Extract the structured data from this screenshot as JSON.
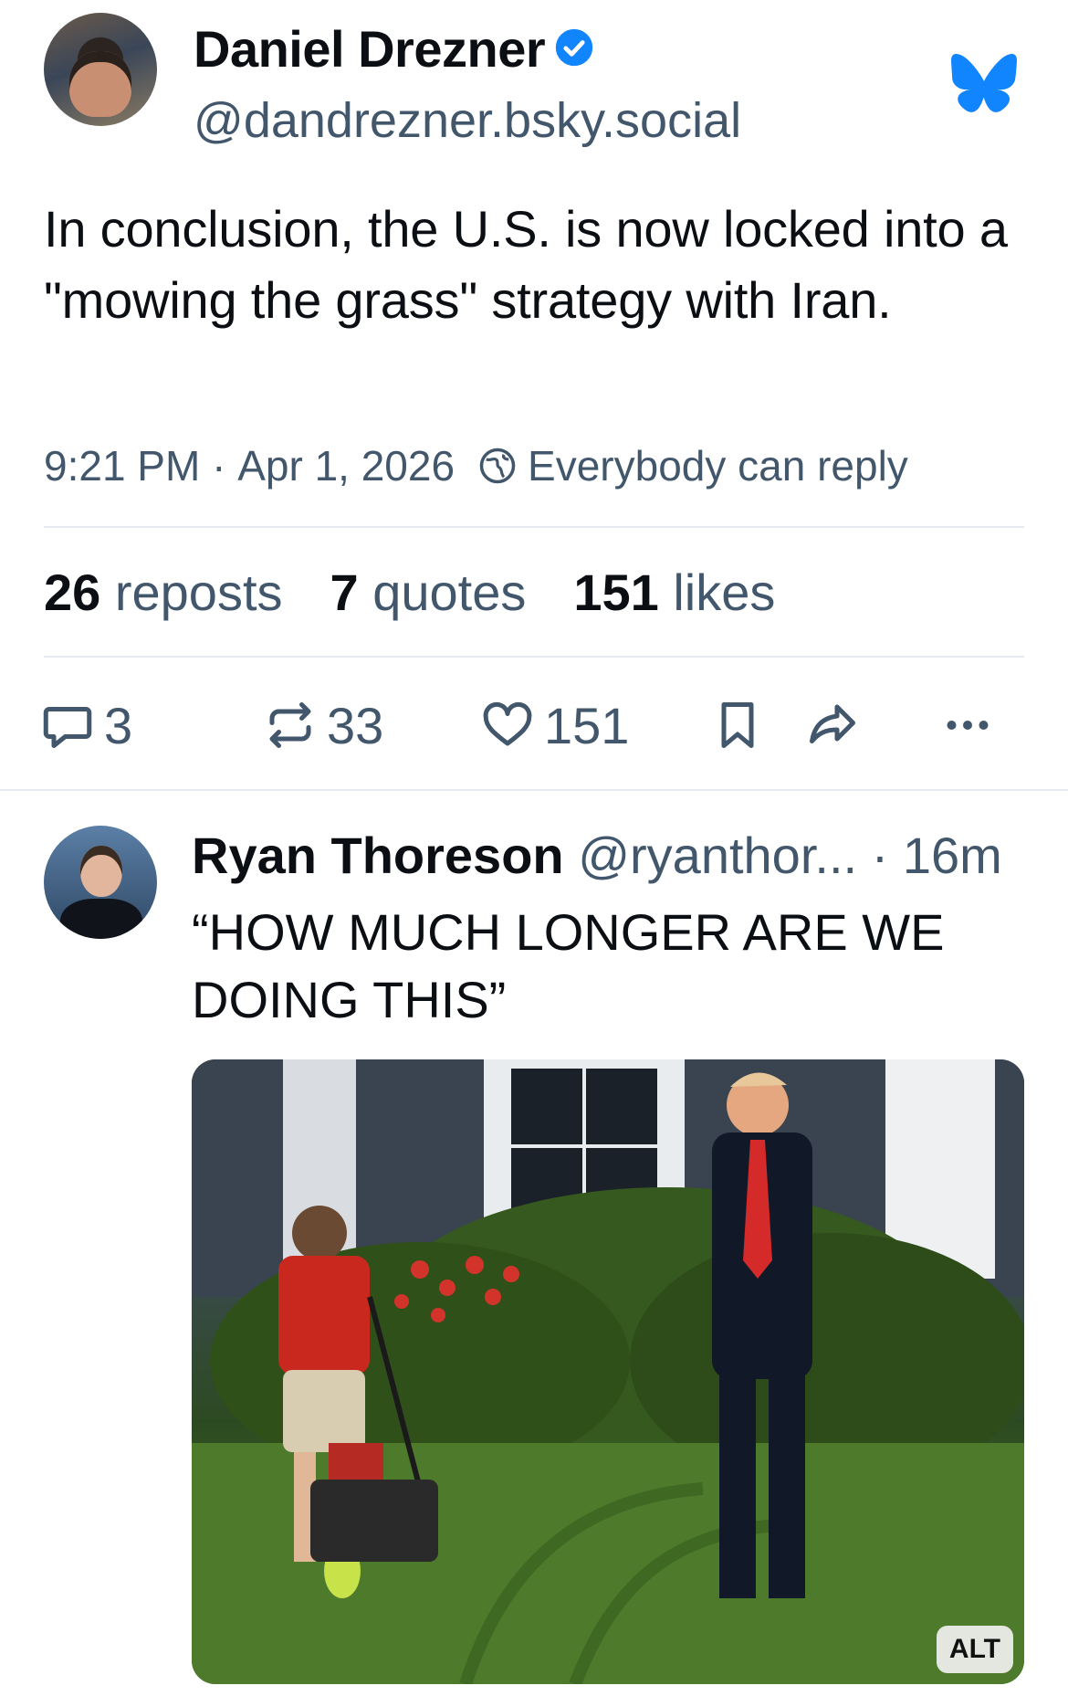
{
  "post": {
    "author_name": "Daniel Drezner",
    "author_handle": "@dandrezner.bsky.social",
    "text": "In conclusion, the U.S. is now locked into a \"mowing the grass\" strategy with Iran.",
    "time": "9:21 PM",
    "date": "Apr 1, 2026",
    "reply_setting": "Everybody can reply",
    "stats": {
      "reposts_count": "26",
      "reposts_label": "reposts",
      "quotes_count": "7",
      "quotes_label": "quotes",
      "likes_count": "151",
      "likes_label": "likes"
    },
    "actions": {
      "reply_count": "3",
      "repost_count": "33",
      "like_count": "151"
    }
  },
  "reply": {
    "author_name": "Ryan Thoreson",
    "author_handle": "@ryanthor...",
    "time": "· 16m",
    "text": "“HOW MUCH LONGER ARE WE DOING THIS”",
    "image_alt_badge": "ALT"
  },
  "colors": {
    "text": "#0b0f14",
    "muted": "#42576c",
    "brand_blue": "#1185fe",
    "divider": "#e6eaee"
  },
  "icons": [
    "verified-badge-icon",
    "bluesky-butterfly-icon",
    "globe-icon",
    "reply-bubble-icon",
    "repost-icon",
    "heart-icon",
    "bookmark-icon",
    "share-icon",
    "more-options-icon"
  ]
}
